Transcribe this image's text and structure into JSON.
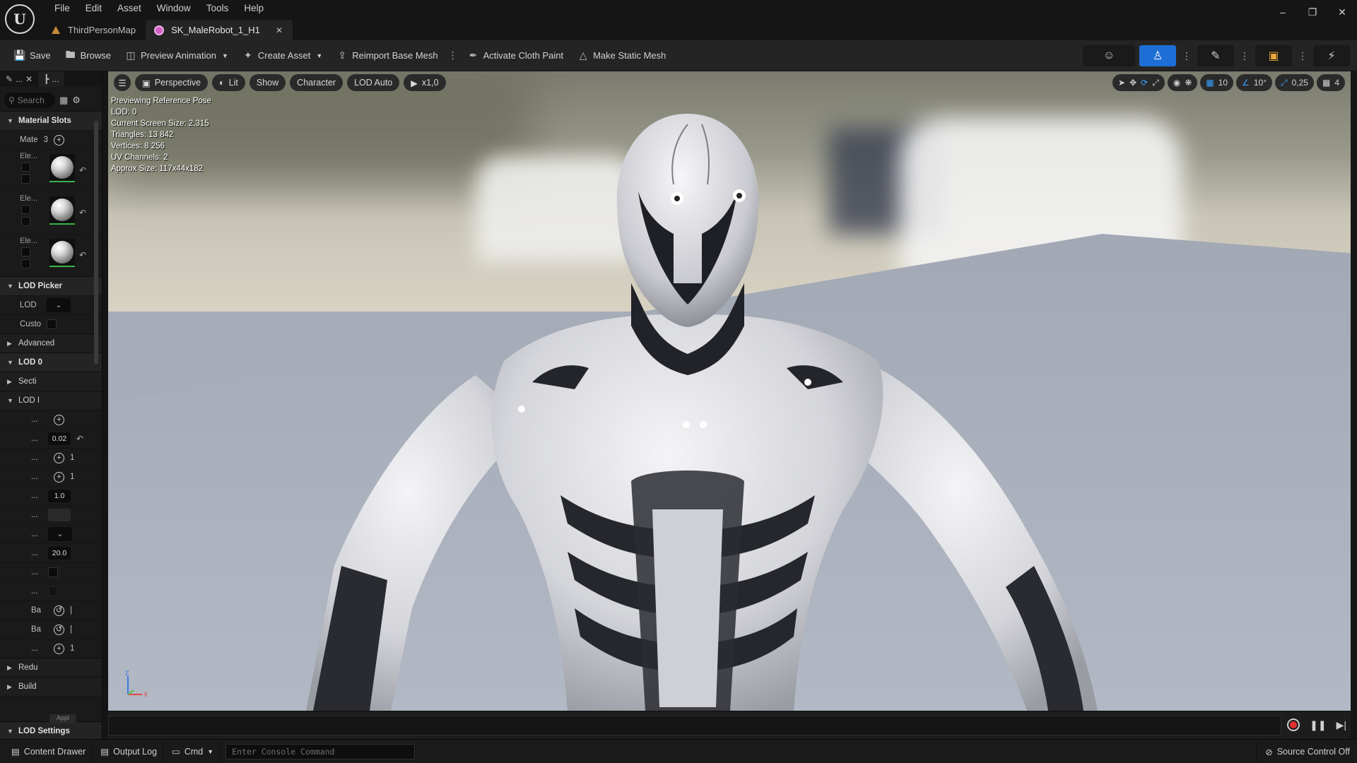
{
  "menu": [
    "File",
    "Edit",
    "Asset",
    "Window",
    "Tools",
    "Help"
  ],
  "tabs": [
    {
      "label": "ThirdPersonMap",
      "icon": "map-icon"
    },
    {
      "label": "SK_MaleRobot_1_H1",
      "icon": "skeletal-mesh-icon",
      "active": true
    }
  ],
  "toolbar": {
    "save": "Save",
    "browse": "Browse",
    "preview_animation": "Preview Animation",
    "create_asset": "Create Asset",
    "reimport": "Reimport Base Mesh",
    "cloth_paint": "Activate Cloth Paint",
    "static_mesh": "Make Static Mesh"
  },
  "details": {
    "search_placeholder": "Search",
    "material_slots": "Material Slots",
    "mate_label": "Mate",
    "mate_count": "3",
    "element_label": "Ele...",
    "lod_picker": "LOD Picker",
    "lod_label": "LOD",
    "custom_label": "Custo",
    "advanced": "Advanced",
    "lod0": "LOD 0",
    "sections": "Secti",
    "lod_info": "LOD I",
    "row_dots": "...",
    "val_1": "0.02",
    "val_2": "1",
    "val_3": "1",
    "val_4": "1.0",
    "val_5": "20.0",
    "ba1": "Ba",
    "ba2": "Ba",
    "val_6": "1",
    "reduction": "Redu",
    "build": "Build",
    "apply": "Appl",
    "lod_settings": "LOD Settings"
  },
  "viewport": {
    "perspective": "Perspective",
    "lit": "Lit",
    "show": "Show",
    "character": "Character",
    "lod_auto": "LOD Auto",
    "speed": "x1,0",
    "grid_snap": "10",
    "rot_snap": "10°",
    "scale_snap": "0,25",
    "cam_speed": "4",
    "stats": [
      "Previewing Reference Pose",
      "LOD: 0",
      "Current Screen Size: 2,315",
      "Triangles: 13 842",
      "Vertices: 8 256",
      "UV Channels: 2",
      "Approx Size: 117x44x182"
    ],
    "axis_z": "Z",
    "axis_x": "X"
  },
  "status": {
    "content_drawer": "Content Drawer",
    "output_log": "Output Log",
    "cmd": "Cmd",
    "console_placeholder": "Enter Console Command",
    "source_control": "Source Control Off"
  },
  "colors": {
    "accent": "#1d6fd6",
    "record": "#e23030",
    "active_green": "#39b54a"
  }
}
